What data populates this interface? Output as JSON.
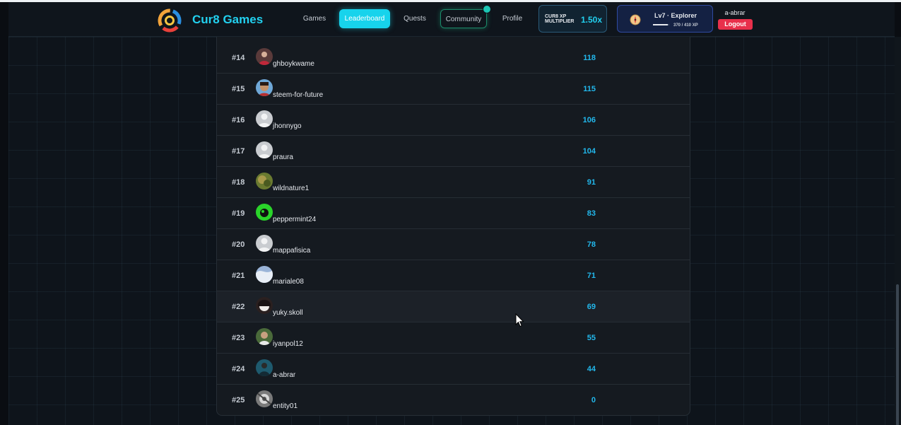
{
  "header": {
    "brand": "Cur8 Games",
    "nav": {
      "games": "Games",
      "leaderboard": "Leaderboard",
      "quests": "Quests",
      "community": "Community",
      "profile": "Profile"
    },
    "multiplier": {
      "label": "CUR8 XP MULTIPLIER",
      "value": "1.50x"
    },
    "level": {
      "title": "Lv7  ·  Explorer",
      "xp_text": "370 / 410 XP",
      "progress": 0.9
    },
    "user": {
      "name": "a-abrar",
      "logout": "Logout"
    }
  },
  "leaderboard": {
    "rows": [
      {
        "rank": "#14",
        "username": "ghboykwame",
        "xp": "118",
        "avatar": "photo-red"
      },
      {
        "rank": "#15",
        "username": "steem-for-future",
        "xp": "115",
        "avatar": "photo-face"
      },
      {
        "rank": "#16",
        "username": "jhonnygo",
        "xp": "106",
        "avatar": "default"
      },
      {
        "rank": "#17",
        "username": "praura",
        "xp": "104",
        "avatar": "default"
      },
      {
        "rank": "#18",
        "username": "wildnature1",
        "xp": "91",
        "avatar": "photo-nature"
      },
      {
        "rank": "#19",
        "username": "peppermint24",
        "xp": "83",
        "avatar": "photo-green"
      },
      {
        "rank": "#20",
        "username": "mappafisica",
        "xp": "78",
        "avatar": "default"
      },
      {
        "rank": "#21",
        "username": "mariale08",
        "xp": "71",
        "avatar": "photo-blue"
      },
      {
        "rank": "#22",
        "username": "yuky.skoll",
        "xp": "69",
        "avatar": "photo-dark"
      },
      {
        "rank": "#23",
        "username": "iyanpol12",
        "xp": "55",
        "avatar": "photo-face2"
      },
      {
        "rank": "#24",
        "username": "a-abrar",
        "xp": "44",
        "avatar": "photo-teal"
      },
      {
        "rank": "#25",
        "username": "entity01",
        "xp": "0",
        "avatar": "photo-gray"
      }
    ],
    "highlighted_row": "#22"
  },
  "colors": {
    "accent": "#22d1f0",
    "xp": "#22b8ec",
    "logout": "#e8304b",
    "level_box": "#142143"
  }
}
